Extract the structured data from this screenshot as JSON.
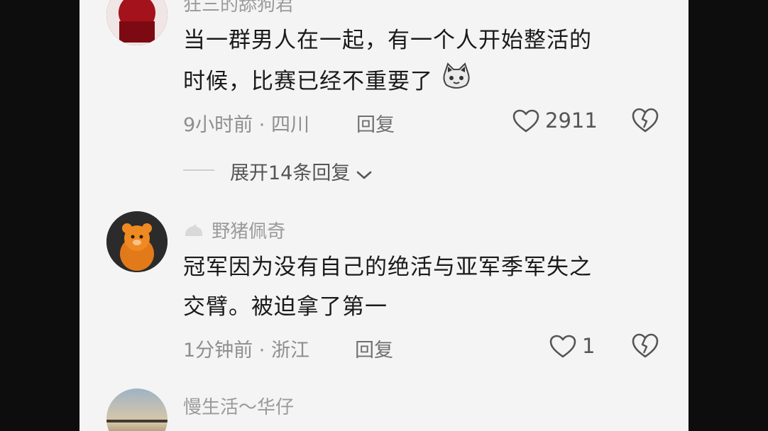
{
  "comments": [
    {
      "username": "狂三的舔狗君",
      "lines": [
        "当一群男人在一起，有一个人开始整活的",
        "时候，比赛已经不重要了"
      ],
      "time": "9小时前",
      "location": "四川",
      "reply_label": "回复",
      "likes": "2911",
      "emoji": "cat-face"
    },
    {
      "expand_label": "展开14条回复"
    },
    {
      "username": "野猪佩奇",
      "lines": [
        "冠军因为没有自己的绝活与亚军季军失之",
        "交臂。被迫拿了第一"
      ],
      "time": "1分钟前",
      "location": "浙江",
      "reply_label": "回复",
      "likes": "1"
    },
    {
      "username": "慢生活～华仔",
      "lines": [
        ""
      ]
    }
  ],
  "colors": {
    "background": "#0d0d0d",
    "panel": "#f4f4f4",
    "text": "#1a1a1a",
    "muted": "#8e8e8e"
  }
}
